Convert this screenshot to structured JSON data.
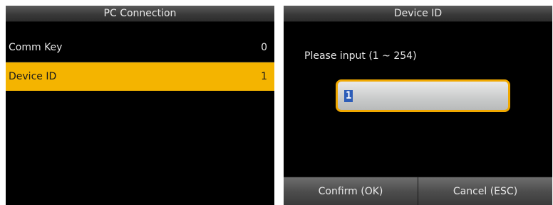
{
  "left_screen": {
    "title": "PC Connection",
    "items": [
      {
        "label": "Comm Key",
        "value": "0"
      },
      {
        "label": "Device ID",
        "value": "1",
        "selected": true
      }
    ]
  },
  "right_screen": {
    "title": "Device ID",
    "prompt": "Please input (1 ~ 254)",
    "input_value": "1",
    "confirm_label": "Confirm (OK)",
    "cancel_label": "Cancel (ESC)"
  },
  "colors": {
    "highlight": "#f4b400",
    "input_border": "#f0a800",
    "text_selection": "#2d5db8",
    "screen_bg": "#000000"
  }
}
